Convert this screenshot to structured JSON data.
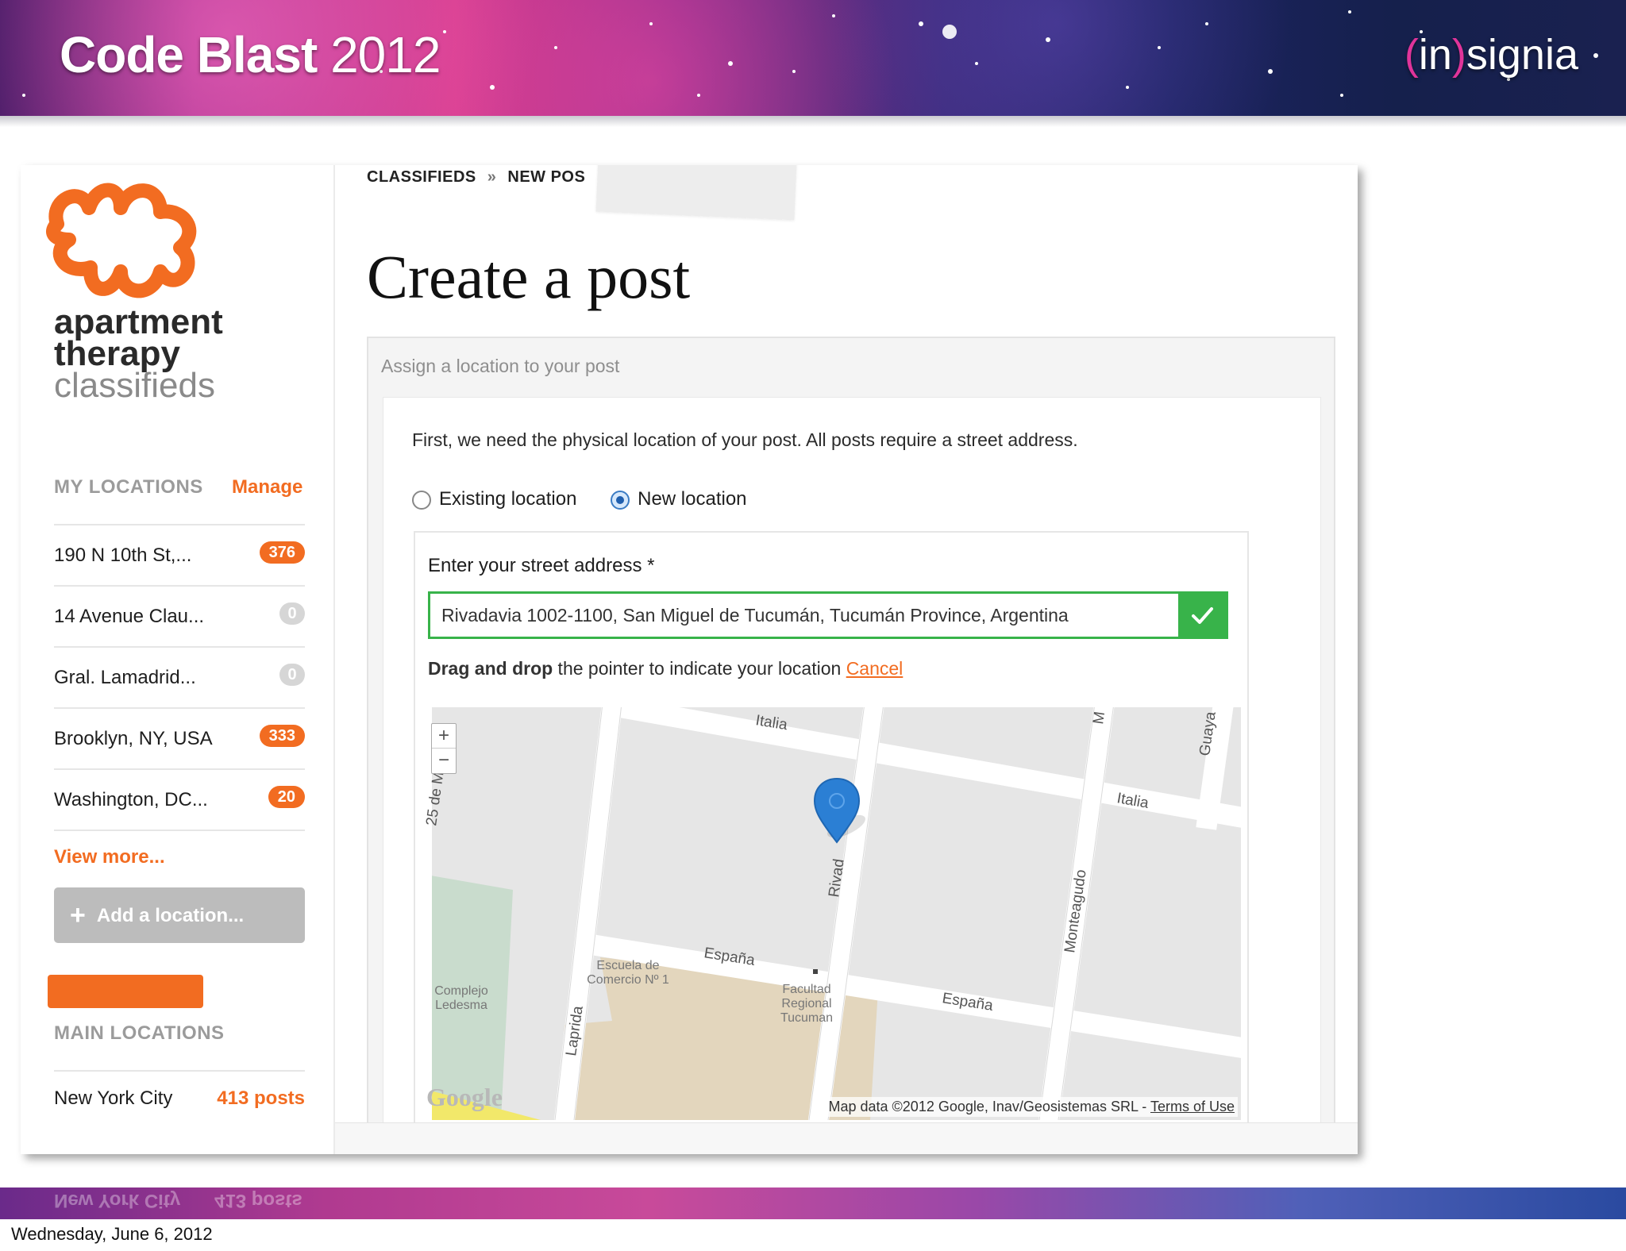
{
  "slide": {
    "title_bold": "Code Blast",
    "title_year": "2012",
    "brand_open": "(",
    "brand_in": "in",
    "brand_close": ")",
    "brand_rest": "signia",
    "date": "Wednesday, June 6, 2012"
  },
  "logo": {
    "line1": "apartment",
    "line2": "therapy",
    "line3": "classifieds",
    "icon": "apartment-therapy-logo-icon",
    "color": "#f26c21"
  },
  "sidebar": {
    "my_locations_label": "MY LOCATIONS",
    "manage_label": "Manage",
    "locations": [
      {
        "name": "190 N 10th St,...",
        "count": "376",
        "style": "orange"
      },
      {
        "name": "14 Avenue Clau...",
        "count": "0",
        "style": "gray"
      },
      {
        "name": "Gral. Lamadrid...",
        "count": "0",
        "style": "gray"
      },
      {
        "name": "Brooklyn, NY, USA",
        "count": "333",
        "style": "orange"
      },
      {
        "name": "Washington, DC...",
        "count": "20",
        "style": "orange"
      }
    ],
    "view_more_label": "View more...",
    "add_location_label": "Add a location...",
    "main_locations_label": "MAIN LOCATIONS",
    "main_locations": [
      {
        "name": "New York City",
        "posts": "413 posts"
      }
    ]
  },
  "breadcrumb": {
    "item1": "CLASSIFIEDS",
    "separator": "»",
    "item2": "NEW POS"
  },
  "page": {
    "title": "Create a post",
    "panel_heading": "Assign a location to your post",
    "intro": "First, we need the physical location of your post. All posts require a street address.",
    "radio_existing": "Existing location",
    "radio_new": "New location",
    "selected_radio": "New location",
    "address_label": "Enter your street address *",
    "address_value": "Rivadavia 1002-1100, San Miguel de Tucumán, Tucumán Province, Argentina",
    "hint_bold": "Drag and drop",
    "hint_rest": " the pointer to indicate your location ",
    "cancel_label": "Cancel"
  },
  "map": {
    "zoom_in": "+",
    "zoom_out": "−",
    "streets": {
      "italia1": "Italia",
      "italia2": "Italia",
      "espana1": "España",
      "espana2": "España",
      "monteagudo": "Monteagudo",
      "rivadavia": "Rivad",
      "laprida": "Laprida",
      "guayaquil": "Guaya",
      "sm": "M",
      "mayo": "25 de M"
    },
    "pois": {
      "escuela1": "Escuela de",
      "escuela2": "Comercio Nº 1",
      "facultad1": "Facultad",
      "facultad2": "Regional",
      "facultad3": "Tucuman",
      "complejo1": "Complejo",
      "complejo2": "Ledesma"
    },
    "google_logo": "Google",
    "credit": "Map data ©2012 Google, Inav/Geosistemas SRL - ",
    "terms": "Terms of Use",
    "pin_color": "#2b7fd4"
  },
  "colors": {
    "accent": "#f26c21",
    "valid": "#38b34a"
  }
}
